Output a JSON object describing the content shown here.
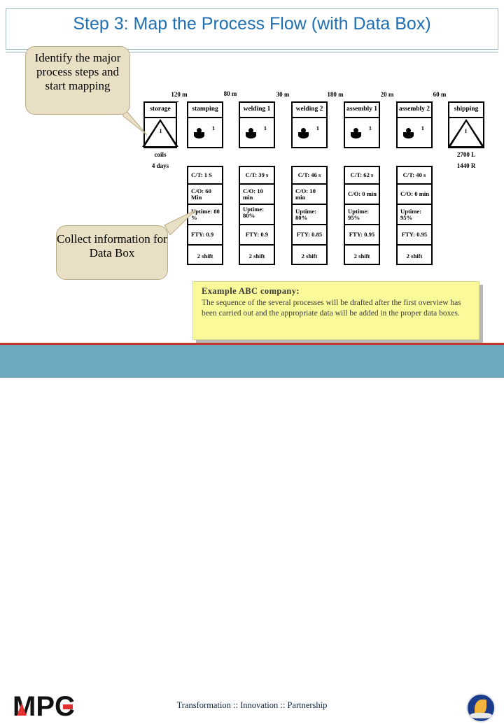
{
  "slide": {
    "title": "Step 3: Map the Process Flow (with Data Box)"
  },
  "callouts": [
    {
      "id": "identify",
      "text": "Identify the major process steps and start mapping"
    },
    {
      "id": "collect",
      "text": "Collect information for Data Box"
    }
  ],
  "flow": {
    "distances": [
      "120 m",
      "80 m",
      "30 m",
      "180 m",
      "20 m",
      "60 m"
    ],
    "steps": [
      {
        "name": "storage",
        "type": "inventory",
        "count": "I",
        "inv_label": "coils",
        "inv_time": "4 days"
      },
      {
        "name": "stamping",
        "type": "process",
        "operators": "1"
      },
      {
        "name": "welding 1",
        "type": "process",
        "operators": "1"
      },
      {
        "name": "welding 2",
        "type": "process",
        "operators": "1"
      },
      {
        "name": "assembly 1",
        "type": "process",
        "operators": "1"
      },
      {
        "name": "assembly 2",
        "type": "process",
        "operators": "1"
      },
      {
        "name": "shipping",
        "type": "inventory",
        "count": "I",
        "inv_label": "2700 L",
        "inv_time": "1440 R"
      }
    ]
  },
  "data_boxes": [
    {
      "process": "stamping",
      "rows": [
        "C/T: 1 S",
        "C/O: 60 Min",
        "Uptime: 80 %",
        "FTY: 0.9",
        "2 shift"
      ]
    },
    {
      "process": "welding 1",
      "rows": [
        "C/T: 39 s",
        "C/O: 10 min",
        "Uptime: 80%",
        "FTY: 0.9",
        "2 shift"
      ]
    },
    {
      "process": "welding 2",
      "rows": [
        "C/T: 46 s",
        "C/O: 10 min",
        "Uptime: 80%",
        "FTY: 0.85",
        "2 shift"
      ]
    },
    {
      "process": "assembly 1",
      "rows": [
        "C/T: 62 s",
        "C/O: 0 min",
        "Uptime: 95%",
        "FTY: 0.95",
        "2 shift"
      ]
    },
    {
      "process": "assembly 2",
      "rows": [
        "C/T: 40 s",
        "C/O: 0 min",
        "Uptime: 95%",
        "FTY: 0.95",
        "2 shift"
      ]
    }
  ],
  "example": {
    "title": "Example ABC company:",
    "text": "The sequence of the several processes will be drafted after the first overview has been carried out and the appropriate data will be added in the proper data boxes."
  },
  "footer": {
    "logo": "MPC",
    "tagline": "Transformation :: Innovation :: Partnership"
  },
  "colors": {
    "title": "#1F6FB5",
    "callout_bg": "#E8DFC4",
    "example_bg": "#FAFA9B",
    "footer_bg": "#6EA8BE",
    "rule": "#C0392B"
  }
}
